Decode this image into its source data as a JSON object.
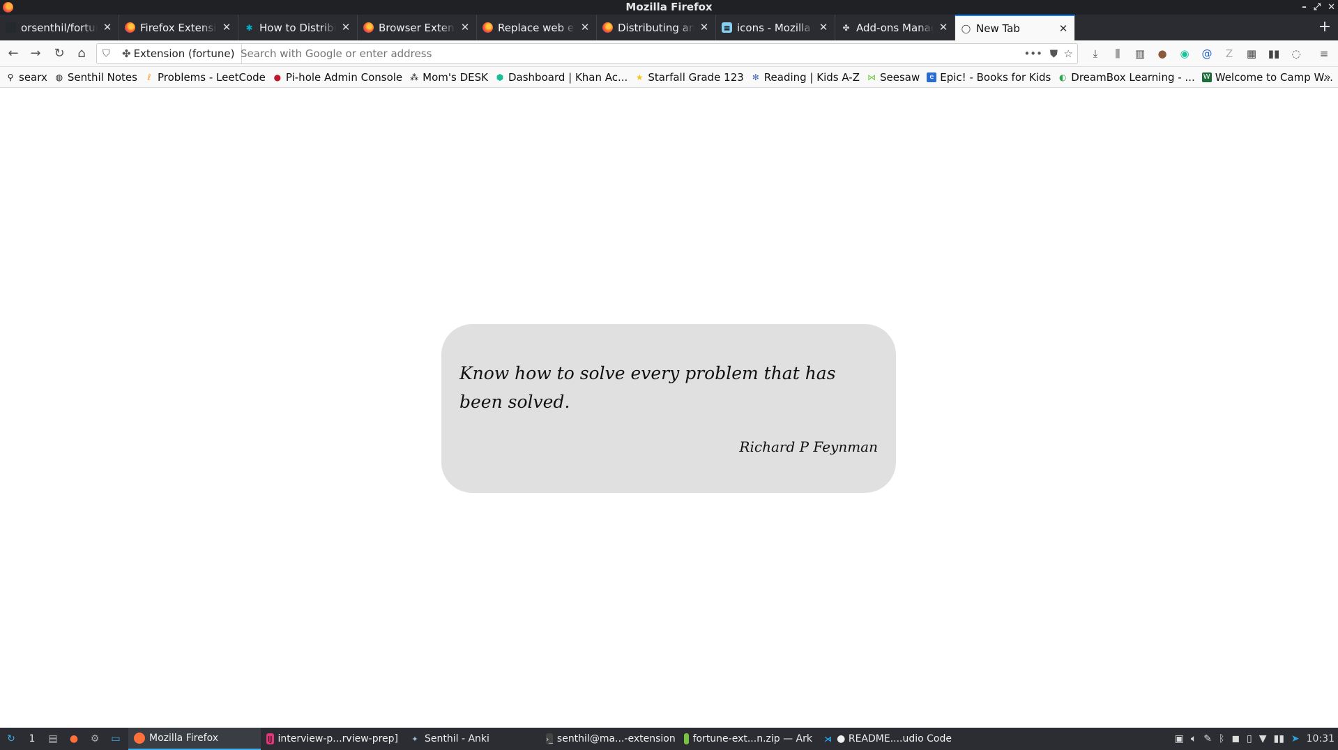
{
  "window": {
    "title": "Mozilla Firefox"
  },
  "tabs": [
    {
      "label": "orsenthil/fortune-bro",
      "favicon": "github-icon"
    },
    {
      "label": "Firefox Extension Wo",
      "favicon": "firefox-icon"
    },
    {
      "label": "How to Distribute thi",
      "favicon": "distribute-icon"
    },
    {
      "label": "Browser Extension D",
      "favicon": "firefox-icon"
    },
    {
      "label": "Replace web extensio",
      "favicon": "firefox-icon"
    },
    {
      "label": "Distributing an add-o",
      "favicon": "firefox-icon"
    },
    {
      "label": "icons - Mozilla | MDN",
      "favicon": "mdn-icon"
    },
    {
      "label": "Add-ons Manager",
      "favicon": "puzzle-icon"
    },
    {
      "label": "New Tab",
      "favicon": "chat-icon",
      "active": true
    }
  ],
  "navbar": {
    "identity_label": "Extension (fortune)",
    "search_placeholder": "Search with Google or enter address",
    "page_actions_label": "•••"
  },
  "bookmarks": [
    {
      "label": "searx",
      "icon": "search-icon"
    },
    {
      "label": "Senthil Notes",
      "icon": "globe-icon"
    },
    {
      "label": "Problems - LeetCode",
      "icon": "leetcode-icon"
    },
    {
      "label": "Pi-hole Admin Console",
      "icon": "pihole-icon"
    },
    {
      "label": "Mom's DESK",
      "icon": "desk-icon"
    },
    {
      "label": "Dashboard | Khan Ac...",
      "icon": "khan-icon"
    },
    {
      "label": "Starfall Grade 123",
      "icon": "starfall-icon"
    },
    {
      "label": "Reading | Kids A-Z",
      "icon": "reading-icon"
    },
    {
      "label": "Seesaw",
      "icon": "seesaw-icon"
    },
    {
      "label": "Epic! - Books for Kids",
      "icon": "epic-icon"
    },
    {
      "label": "DreamBox Learning - ...",
      "icon": "dreambox-icon"
    },
    {
      "label": "Welcome to Camp W...",
      "icon": "camp-icon"
    }
  ],
  "quote": {
    "text": "Know how to solve every problem that has been solved.",
    "author": "Richard P Feynman"
  },
  "taskbar": {
    "workspace": "1",
    "tasks": [
      {
        "label": "Mozilla Firefox",
        "active": true
      },
      {
        "label": "interview-p...rview-prep]"
      },
      {
        "label": "Senthil - Anki"
      },
      {
        "label": "senthil@ma...-extension"
      },
      {
        "label": "fortune-ext...n.zip — Ark"
      },
      {
        "label": "● README....udio Code"
      }
    ],
    "clock": "10:31"
  },
  "colors": {
    "accent": "#0a84ff",
    "card_bg": "#e0e0e0",
    "tab_strip": "#2b2c31",
    "taskbar": "#2b2d33"
  }
}
